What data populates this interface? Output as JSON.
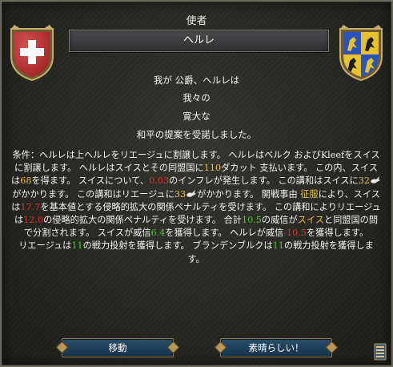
{
  "dialog": {
    "title": "使者",
    "banner": "ヘルレ",
    "lines": [
      "我が 公爵、ヘルレは",
      "我々の",
      "寛大な",
      "和平の提案を受諾しました。"
    ],
    "terms": {
      "p1": "条件：ヘルレは上ヘルレをリエージュに割譲します。 ヘルレはベルク およびKleefをスイスに割譲します。 ヘルレはスイスとその同盟国に",
      "ducats": "110",
      "p2": "ダカット 支払います。 この内、スイスは",
      "swiss_share": "68",
      "p3": "を得ます。 スイスについて、",
      "inflation": "0.03",
      "p4": "のインフレが発生します。 この講和はスイスに",
      "swiss_cost": "32",
      "p5": "がかかります。 この講和はリエージュに",
      "liege_cost": "33",
      "p6": "がかかります。 開戦事由 ",
      "cb_name": "征服",
      "p7": "により、スイスは",
      "swiss_ae": "17.7",
      "p8": "を基本値とする侵略的拡大の関係ペナルティを受けます。 この講和によりリエージュは",
      "liege_ae": "12.0",
      "p9": "の侵略的拡大の関係ペナルティを受けます。 合計",
      "prestige_total": "10.5",
      "p10": "の威信が",
      "swiss_name": "スイス",
      "p11": "と同盟国の間で分割されます。 スイスが威信",
      "swiss_prestige": "6.4",
      "p12": "を獲得します。 ヘルレが威信",
      "gelre_prestige": "-10.5",
      "p13": "を獲得します。",
      "p14": "リエージュは",
      "liege_war": "11",
      "p15": "の戦力投射を獲得します。 ブランデンブルクは",
      "brand_war": "11",
      "p16": "の戦力投射を獲得します。"
    },
    "buttons": {
      "move": "移動",
      "ok": "素晴らしい！"
    },
    "icons": [
      "dove-icon",
      "ledger-icon"
    ],
    "colors": {
      "yellow": "#e6c24a",
      "red": "#e0302a",
      "green": "#54c23a",
      "button": "#1f4260"
    }
  }
}
